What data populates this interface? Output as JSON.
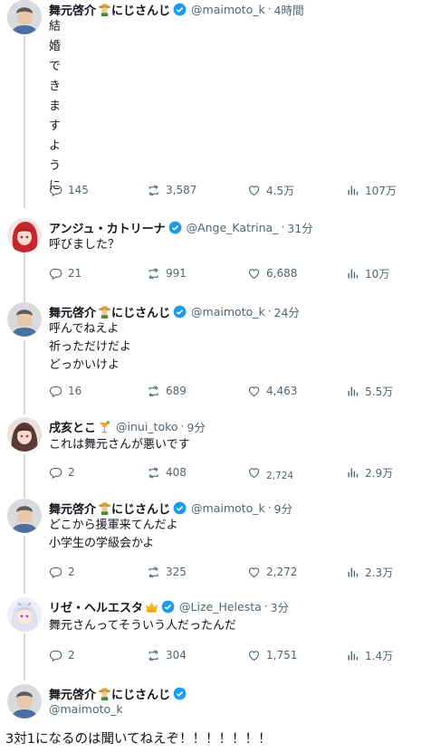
{
  "tweets": [
    {
      "name": "舞元啓介",
      "name_suffix": "にじさんじ",
      "handle": "@maimoto_k",
      "time": "4時間",
      "text": "結婚できますように",
      "replies": "145",
      "retweets": "3,587",
      "likes": "4.5万",
      "views": "107万"
    },
    {
      "name": "アンジュ・カトリーナ",
      "handle": "@Ange_Katrina_",
      "time": "31分",
      "text": "呼びました？",
      "replies": "21",
      "retweets": "991",
      "likes": "6,688",
      "views": "10万"
    },
    {
      "name": "舞元啓介",
      "name_suffix": "にじさんじ",
      "handle": "@maimoto_k",
      "time": "24分",
      "lines": [
        "呼んでねえよ",
        "祈っただけだよ",
        "どっかいけよ"
      ],
      "replies": "16",
      "retweets": "689",
      "likes": "4,463",
      "views": "5.5万"
    },
    {
      "name": "戌亥とこ",
      "handle": "@inui_toko",
      "time": "9分",
      "text": "これは舞元さんが悪いです",
      "replies": "2",
      "retweets": "408",
      "likes": "2,724",
      "views": "2.9万"
    },
    {
      "name": "舞元啓介",
      "name_suffix": "にじさんじ",
      "handle": "@maimoto_k",
      "time": "9分",
      "lines": [
        "どこから援軍来てんだよ",
        "小学生の学級会かよ"
      ],
      "replies": "2",
      "retweets": "325",
      "likes": "2,272",
      "views": "2.3万"
    },
    {
      "name": "リゼ・ヘルエスタ",
      "handle": "@Lize_Helesta",
      "time": "3分",
      "text": "舞元さんってそういう人だったんだ",
      "replies": "2",
      "retweets": "304",
      "likes": "1,751",
      "views": "1.4万"
    }
  ],
  "final_tweet": {
    "name": "舞元啓介",
    "name_suffix": "にじさんじ",
    "handle": "@maimoto_k",
    "text": "3対1になるのは聞いてねえぞ！！！！！！！"
  },
  "colors": {
    "verified": "#1d9bf0",
    "muted": "#536471",
    "thread_line": "#cfd9de"
  },
  "icons": [
    "reply-icon",
    "retweet-icon",
    "like-icon",
    "views-icon",
    "verified-badge-icon"
  ]
}
